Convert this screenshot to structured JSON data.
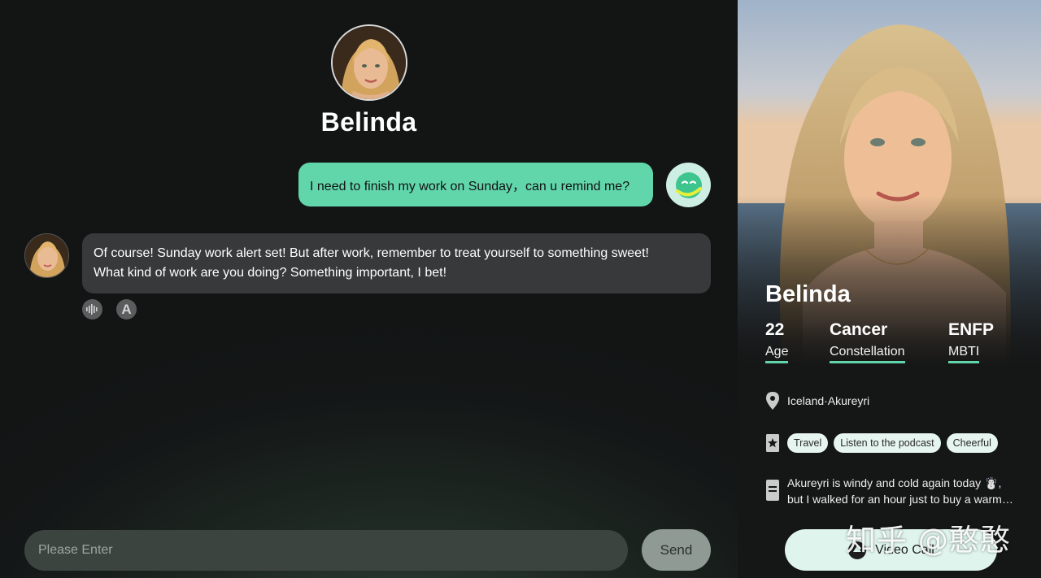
{
  "chat": {
    "character_name": "Belinda",
    "messages": [
      {
        "role": "user",
        "text": "I need to finish my work on Sunday，can u remind me?"
      },
      {
        "role": "assistant",
        "lines": [
          "Of course! Sunday work alert set! But after work, remember to treat yourself to something sweet!",
          "What kind of work are you doing? Something important, I bet!"
        ]
      }
    ],
    "actions": {
      "voice_icon": "sound-wave-icon",
      "translate_label": "A"
    },
    "input": {
      "placeholder": "Please Enter"
    },
    "send_label": "Send"
  },
  "profile": {
    "name": "Belinda",
    "stats": [
      {
        "value": "22",
        "label": "Age"
      },
      {
        "value": "Cancer",
        "label": "Constellation"
      },
      {
        "value": "ENFP",
        "label": "MBTI"
      }
    ],
    "location": "Iceland·Akureyri",
    "tags": [
      "Travel",
      "Listen to the podcast",
      "Cheerful"
    ],
    "bio_lines": [
      "Akureyri is windy and cold again today ☃️,",
      "but I walked for an hour just to buy a warm cup of coffee"
    ],
    "video_call_label": "Video Call"
  },
  "watermark": "知乎 @憨憨",
  "colors": {
    "accent": "#62d6ab",
    "user_bubble": "#62d6ab",
    "bot_bubble": "#37393a",
    "background": "#131515"
  }
}
